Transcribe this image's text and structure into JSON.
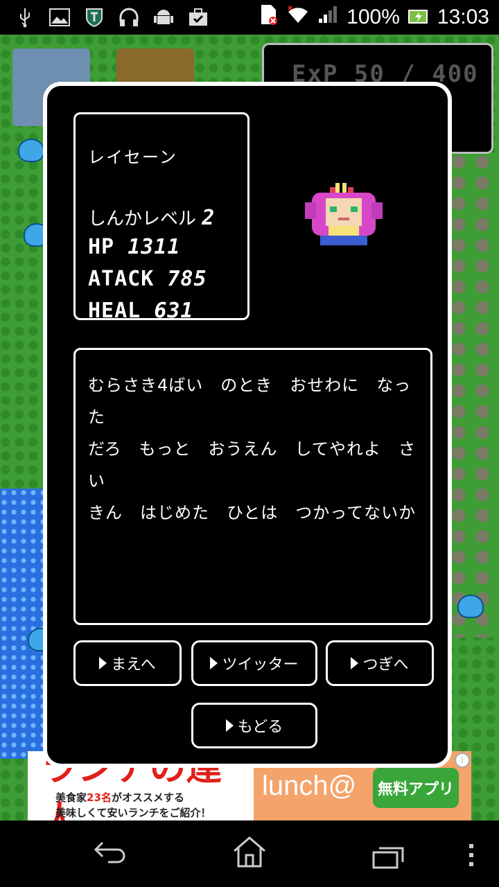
{
  "status_bar": {
    "battery_percent": "100%",
    "time": "13:03",
    "icons": [
      "usb-icon",
      "image-icon",
      "shield-icon",
      "headphones-icon",
      "android-icon",
      "briefcase-icon",
      "sim-error-icon",
      "wifi-icon",
      "signal-icon",
      "battery-icon"
    ]
  },
  "exp_panel": {
    "text": "ExP 50 / 400"
  },
  "character": {
    "name": "レイセーン",
    "level_label": "しんかレベル",
    "level_value": "2",
    "hp_label": "HP",
    "hp_value": "1311",
    "atack_label": "ATACK",
    "atack_value": "785",
    "heal_label": "HEAL",
    "heal_value": "631"
  },
  "message": "むらさき4ばい　のとき　おせわに　なった\nだろ　もっと　おうえん　してやれよ　さい\nきん　はじめた　ひとは　つかってないか",
  "buttons": {
    "prev": "まえへ",
    "twitter": "ツイッター",
    "next": "つぎへ",
    "back": "もどる"
  },
  "ad": {
    "headline": "ランチの達人",
    "line1_a": "美食家",
    "line1_b": "23名",
    "line1_c": "がオススメする",
    "line2": "美味しくて安いランチをご紹介！",
    "brand": "lunch@",
    "cta": "無料アプリ",
    "info": "i"
  },
  "colors": {
    "frame": "#ffffff",
    "background": "#000000",
    "grass": "#3e9d35",
    "water": "#2a6fe0"
  }
}
